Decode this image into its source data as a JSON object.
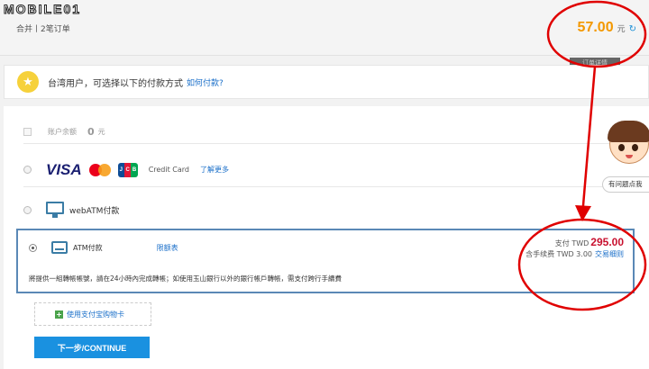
{
  "watermark": "MOBILE01",
  "order": {
    "info": "合并丨2笔订单",
    "amount": "57.00",
    "currency": "元",
    "refresh_icon": "refresh-icon",
    "details_tag": "订单详情"
  },
  "notice": {
    "text": "台湾用户，可选择以下的付款方式",
    "link": "如何付款?"
  },
  "balance": {
    "label": "账户余额",
    "value": "0",
    "unit": "元"
  },
  "credit_card": {
    "label": "Credit Card",
    "more": "了解更多",
    "brands": [
      "VISA",
      "mastercard",
      "JCB"
    ]
  },
  "webatm": {
    "label": "webATM付款"
  },
  "atm": {
    "label": "ATM付款",
    "limit_link": "限额表",
    "pay_label": "支付 TWD",
    "pay_amount": "295.00",
    "fee_label": "含手续费 TWD 3.00",
    "fee_link": "交易细则",
    "description": "將提供一組轉帳帳號，請在24小時內完成轉帳；如使用玉山銀行以外的銀行帳戶轉帳，需支付跨行手續費"
  },
  "gift_card": {
    "label": "使用支付宝购物卡"
  },
  "next_button": {
    "label": "下一步/CONTINUE"
  },
  "helper": {
    "bubble": "有问题点我"
  },
  "annotation_color": "#e00000",
  "accent_color": "#f39800"
}
